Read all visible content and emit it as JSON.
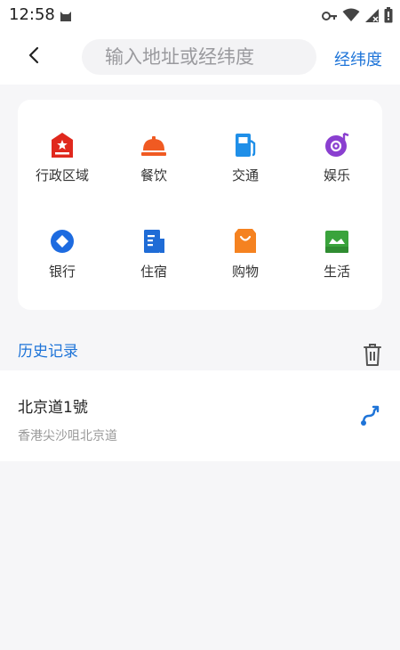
{
  "status_bar": {
    "time": "12:58",
    "icons": [
      "cat-icon",
      "key-icon",
      "wifi-icon",
      "signal-icon",
      "battery-icon"
    ]
  },
  "header": {
    "back_icon": "chevron-left-icon",
    "search_placeholder": "输入地址或经纬度",
    "coord_link": "经纬度"
  },
  "categories": [
    {
      "label": "行政区域",
      "icon": "government-building-icon",
      "color": "#e0281d"
    },
    {
      "label": "餐饮",
      "icon": "food-cloche-icon",
      "color": "#f05a22"
    },
    {
      "label": "交通",
      "icon": "gas-station-icon",
      "color": "#1f8fe8"
    },
    {
      "label": "娱乐",
      "icon": "music-disc-icon",
      "color": "#8a3fd0"
    },
    {
      "label": "银行",
      "icon": "bank-coin-icon",
      "color": "#1d6be0"
    },
    {
      "label": "住宿",
      "icon": "hotel-building-icon",
      "color": "#1f6cd6"
    },
    {
      "label": "购物",
      "icon": "shopping-bag-icon",
      "color": "#f58220"
    },
    {
      "label": "生活",
      "icon": "shop-store-icon",
      "color": "#3aa33c"
    }
  ],
  "history": {
    "title": "历史记录",
    "clear_icon": "trash-icon",
    "items": [
      {
        "name": "北京道1號",
        "address": "香港尖沙咀北京道",
        "action_icon": "route-icon"
      }
    ]
  },
  "colors": {
    "accent": "#1e74d8",
    "background": "#f6f6f8",
    "card": "#ffffff"
  }
}
